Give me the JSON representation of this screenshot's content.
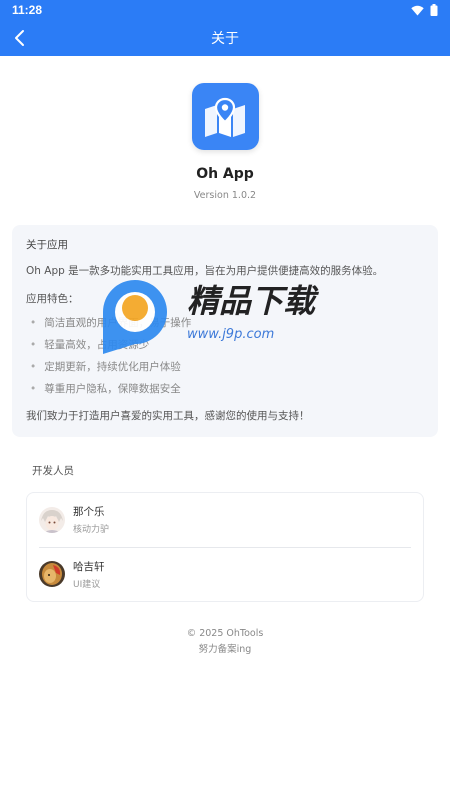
{
  "status": {
    "time": "11:28"
  },
  "appbar": {
    "title": "关于"
  },
  "hero": {
    "app_name": "Oh App",
    "version": "Version 1.0.2"
  },
  "about": {
    "title": "关于应用",
    "description": "Oh App 是一款多功能实用工具应用，旨在为用户提供便捷高效的服务体验。",
    "features_title": "应用特色：",
    "features": [
      "简洁直观的用户界面，易于操作",
      "轻量高效，占用资源少",
      "定期更新，持续优化用户体验",
      "尊重用户隐私，保障数据安全"
    ],
    "closing": "我们致力于打造用户喜爱的实用工具，感谢您的使用与支持！"
  },
  "developers": {
    "title": "开发人员",
    "list": [
      {
        "name": "那个乐",
        "role": "核动力驴"
      },
      {
        "name": "哈吉轩",
        "role": "UI建议"
      }
    ]
  },
  "footer": {
    "copyright": "© 2025 OhTools",
    "icp": "努力备案ing"
  },
  "watermark": {
    "text": "精品下载",
    "url": "www.j9p.com"
  },
  "colors": {
    "primary": "#2b7cf6",
    "card_bg": "#f4f6fa"
  },
  "icons": {
    "back": "chevron-left-icon",
    "wifi": "wifi-icon",
    "battery": "battery-icon",
    "app": "map-icon"
  }
}
